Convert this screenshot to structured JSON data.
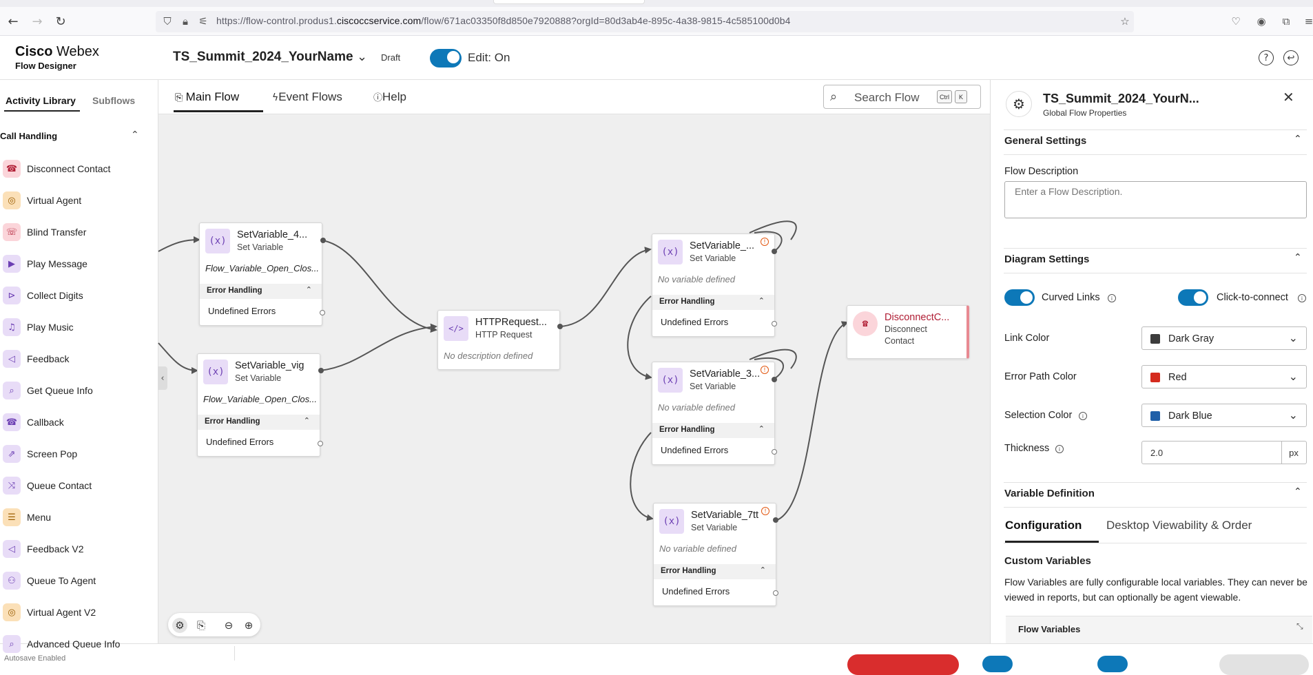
{
  "browser": {
    "url_prefix": "https://flow-control.produs1.",
    "url_domain": "ciscoccservice.com",
    "url_suffix": "/flow/671ac03350f8d850e7920888?orgId=80d3ab4e-895c-4a38-9815-4c585100d0b4"
  },
  "header": {
    "brand_line1_bold": "Cisco",
    "brand_line1_rest": " Webex",
    "brand_line2": "Flow Designer",
    "flow_title": "TS_Summit_2024_YourName",
    "status": "Draft",
    "edit_label": "Edit: On",
    "accent": "#0d78b8"
  },
  "sidebar": {
    "tabs": [
      "Activity Library",
      "Subflows"
    ],
    "section": "Call Handling",
    "items": [
      {
        "label": "Disconnect Contact",
        "icon": "disconnect-phone-icon",
        "glyph": "☎",
        "style": "pink"
      },
      {
        "label": "Virtual Agent",
        "icon": "robot-icon",
        "glyph": "◎",
        "style": "orange"
      },
      {
        "label": "Blind Transfer",
        "icon": "transfer-phone-icon",
        "glyph": "☏",
        "style": "pink"
      },
      {
        "label": "Play Message",
        "icon": "play-circle-icon",
        "glyph": "▶",
        "style": "purple"
      },
      {
        "label": "Collect Digits",
        "icon": "digits-icon",
        "glyph": "⊳",
        "style": "purple"
      },
      {
        "label": "Play Music",
        "icon": "music-icon",
        "glyph": "♫",
        "style": "purple"
      },
      {
        "label": "Feedback",
        "icon": "megaphone-icon",
        "glyph": "◁",
        "style": "purple"
      },
      {
        "label": "Get Queue Info",
        "icon": "magnifier-icon",
        "glyph": "⌕",
        "style": "purple"
      },
      {
        "label": "Callback",
        "icon": "callback-icon",
        "glyph": "☎",
        "style": "purple"
      },
      {
        "label": "Screen Pop",
        "icon": "screen-pop-icon",
        "glyph": "⇗",
        "style": "purple"
      },
      {
        "label": "Queue Contact",
        "icon": "shuffle-icon",
        "glyph": "⤨",
        "style": "purple"
      },
      {
        "label": "Menu",
        "icon": "menu-list-icon",
        "glyph": "☰",
        "style": "orange"
      },
      {
        "label": "Feedback V2",
        "icon": "megaphone-icon",
        "glyph": "◁",
        "style": "purple"
      },
      {
        "label": "Queue To Agent",
        "icon": "agent-queue-icon",
        "glyph": "⚇",
        "style": "purple"
      },
      {
        "label": "Virtual Agent V2",
        "icon": "robot-icon",
        "glyph": "◎",
        "style": "orange"
      },
      {
        "label": "Advanced Queue Info",
        "icon": "magnifier-icon",
        "glyph": "⌕",
        "style": "purple"
      }
    ]
  },
  "canvas": {
    "tabs": [
      "Main Flow",
      "Event Flows",
      "Help"
    ],
    "search_placeholder": "Search Flow",
    "kbd_ctrl": "Ctrl",
    "kbd_k": "K",
    "error_handling": "Error Handling",
    "undefined_errors": "Undefined Errors",
    "nodes": {
      "sv4": {
        "title": "SetVariable_4...",
        "type": "Set Variable",
        "desc": "Flow_Variable_Open_Clos..."
      },
      "svvig": {
        "title": "SetVariable_vig",
        "type": "Set Variable",
        "desc": "Flow_Variable_Open_Clos..."
      },
      "http": {
        "title": "HTTPRequest...",
        "type": "HTTP Request",
        "desc": "No description defined"
      },
      "sva": {
        "title": "SetVariable_...",
        "type": "Set Variable",
        "desc": "No variable defined"
      },
      "sv3": {
        "title": "SetVariable_3...",
        "type": "Set Variable",
        "desc": "No variable defined"
      },
      "sv7": {
        "title": "SetVariable_7tt",
        "type": "Set Variable",
        "desc": "No variable defined"
      },
      "disc": {
        "title": "DisconnectC...",
        "type": "Disconnect Contact",
        "type_line1": "Disconnect",
        "type_line2": "Contact"
      }
    }
  },
  "panel": {
    "title": "TS_Summit_2024_YourN...",
    "subtitle": "Global Flow Properties",
    "general_settings": "General Settings",
    "flow_description_label": "Flow Description",
    "flow_description_placeholder": "Enter a Flow Description.",
    "diagram_settings": "Diagram Settings",
    "curved_links": "Curved Links",
    "click_to_connect": "Click-to-connect",
    "link_color_label": "Link Color",
    "link_color": {
      "value": "Dark Gray",
      "swatch": "#3c3c3c"
    },
    "error_path_label": "Error Path Color",
    "error_path_color": {
      "value": "Red",
      "swatch": "#d52b1e"
    },
    "selection_label": "Selection Color",
    "selection_color": {
      "value": "Dark Blue",
      "swatch": "#1f5fa8"
    },
    "thickness_label": "Thickness",
    "thickness_value": "2.0",
    "thickness_unit": "px",
    "variable_definition": "Variable Definition",
    "tab_configuration": "Configuration",
    "tab_desktop": "Desktop Viewability & Order",
    "custom_variables": "Custom Variables",
    "custom_variables_desc": "Flow Variables are fully configurable local variables. They can never be viewed in reports, but can optionally be agent viewable.",
    "flow_variables": "Flow Variables"
  },
  "footer": {
    "autosave": "Autosave Enabled"
  }
}
